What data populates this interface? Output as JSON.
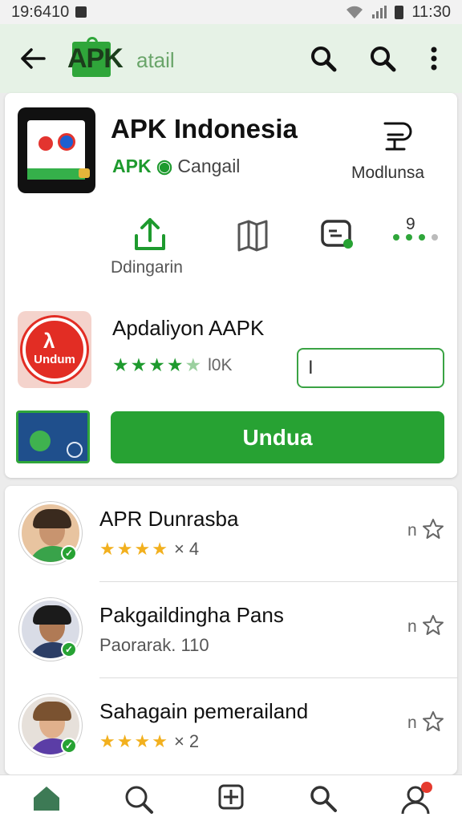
{
  "status_bar": {
    "time_left": "19:6410",
    "time_right": "11:30"
  },
  "app_bar": {
    "logo_text": "APK",
    "title": "atail"
  },
  "app": {
    "name": "APK Indonesia",
    "developer_brand": "APK",
    "developer_suffix": "Cangail",
    "side_action_label": "Modlunsa",
    "actions_label": "Ddingarin",
    "actions_superscript": "9"
  },
  "promo": {
    "icon_label": "Undum",
    "name": "Apdaliyon AAPK",
    "rating_count": "l0K",
    "rating_stars": 4.5,
    "input_value": "I"
  },
  "download_button": {
    "label": "Undua"
  },
  "list": [
    {
      "name": "APR Dunrasba",
      "rating_stars": 4,
      "sub_text": "× 4",
      "meta": "n",
      "body_color": "#39a34a"
    },
    {
      "name": "Pakgaildingha Pans",
      "rating_stars": 0,
      "sub_text": "Paorarak. 110",
      "meta": "n",
      "body_color": "#2c3e66"
    },
    {
      "name": "Sahagain pemerailand",
      "rating_stars": 4,
      "sub_text": "× 2",
      "meta": "n",
      "body_color": "#5b3da6"
    }
  ],
  "bottom_nav": [
    "home-icon",
    "heart-search-icon",
    "grid-add-icon",
    "search-icon",
    "profile-icon"
  ],
  "colors": {
    "brand_green": "#27a233",
    "app_bar_bg": "#e6f2e6",
    "star_gold": "#f2b01e",
    "notify_red": "#e53a2e"
  }
}
